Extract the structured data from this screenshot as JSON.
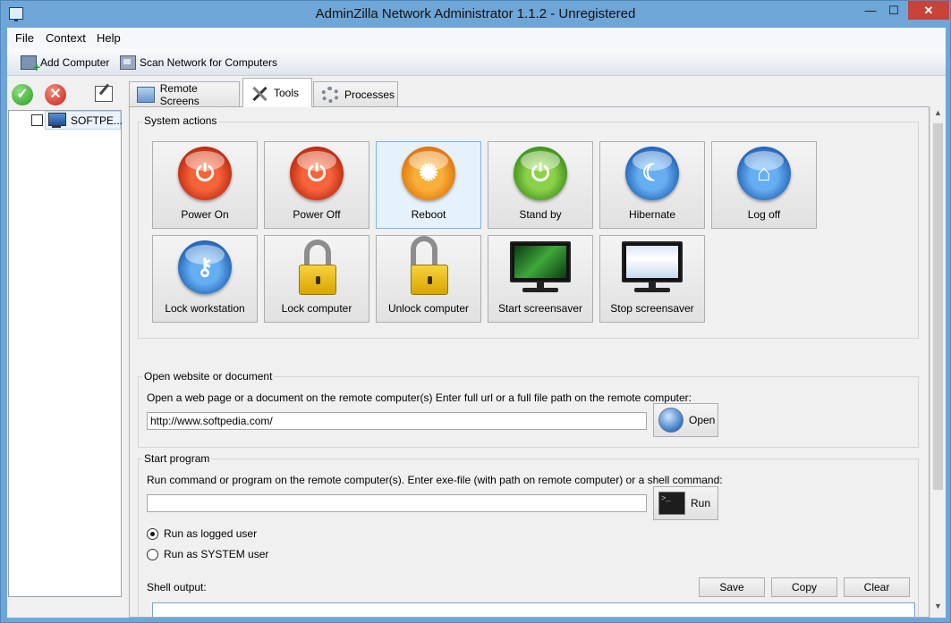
{
  "window": {
    "title": "AdminZilla Network Administrator 1.1.2 - Unregistered",
    "controls": {
      "minimize": "—",
      "maximize": "☐",
      "close": "✕"
    }
  },
  "menubar": {
    "items": [
      "File",
      "Context",
      "Help"
    ]
  },
  "toolbar": {
    "add_computer": {
      "label": "Add Computer",
      "icon": "add-computer-icon"
    },
    "scan_network": {
      "label": "Scan Network for Computers",
      "icon": "scan-network-icon"
    }
  },
  "sidebar": {
    "icons": [
      "check-icon",
      "cancel-icon",
      "edit-list-icon"
    ],
    "tree": [
      {
        "label": "SOFTPE...",
        "checked": false,
        "icon": "computer-icon"
      }
    ]
  },
  "tabs": [
    {
      "label": "Remote Screens",
      "icon": "monitor-icon",
      "active": false
    },
    {
      "label": "Tools",
      "icon": "tools-icon",
      "active": true
    },
    {
      "label": "Processes",
      "icon": "gears-icon",
      "active": false
    }
  ],
  "system_actions": {
    "title": "System actions",
    "buttons": [
      {
        "label": "Power On",
        "icon": "power-on-icon",
        "selected": false
      },
      {
        "label": "Power Off",
        "icon": "power-off-icon",
        "selected": false
      },
      {
        "label": "Reboot",
        "icon": "reboot-icon",
        "selected": true
      },
      {
        "label": "Stand by",
        "icon": "standby-icon",
        "selected": false
      },
      {
        "label": "Hibernate",
        "icon": "moon-icon",
        "selected": false
      },
      {
        "label": "Log off",
        "icon": "home-icon",
        "selected": false
      },
      {
        "label": "Lock workstation",
        "icon": "key-icon",
        "selected": false
      },
      {
        "label": "Lock computer",
        "icon": "padlock-closed-icon",
        "selected": false
      },
      {
        "label": "Unlock computer",
        "icon": "padlock-open-icon",
        "selected": false
      },
      {
        "label": "Start screensaver",
        "icon": "screensaver-on-icon",
        "selected": false
      },
      {
        "label": "Stop screensaver",
        "icon": "screensaver-off-icon",
        "selected": false
      }
    ]
  },
  "open_website": {
    "title": "Open website or document",
    "description": "Open a web page or a document on the remote computer(s) Enter full url or a full file path on the remote computer:",
    "input_value": "http://www.softpedia.com/",
    "button": "Open"
  },
  "start_program": {
    "title": "Start program",
    "description": "Run command or program on the remote computer(s). Enter exe-file (with path on remote computer) or a shell command:",
    "input_value": "",
    "button": "Run",
    "radio": [
      {
        "label": "Run as logged user",
        "selected": true
      },
      {
        "label": "Run as SYSTEM user",
        "selected": false
      }
    ],
    "shell_output_label": "Shell output:",
    "save": "Save",
    "copy": "Copy",
    "clear": "Clear"
  },
  "colors": {
    "window_frame": "#6fa6d8",
    "selected_button": "#e5f1fb",
    "close_button": "#c7423a"
  }
}
